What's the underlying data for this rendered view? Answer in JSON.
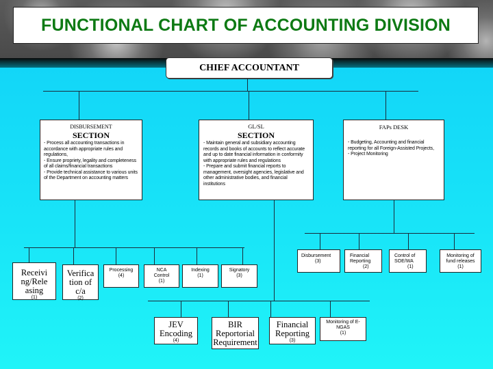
{
  "title": "FUNCTIONAL CHART OF ACCOUNTING DIVISION",
  "colors": {
    "title_text": "#0e7a14",
    "background_top": "#10d0f8",
    "background_bottom": "#20f4f8",
    "box_fill": "#ffffff",
    "line": "#1a2a3a"
  },
  "chief": {
    "label": "CHIEF ACCOUNTANT"
  },
  "sections": [
    {
      "name": "DISBURSEMENT",
      "subtitle": "SECTION",
      "body": "- Process all accounting transactions in accordance with appropriate rules and regulations,\n- Ensure propriety, legality and completeness of all claims/financial transactions\n- Provide technical assistance to various units of the Department on accounting matters"
    },
    {
      "name": "GL/SL",
      "subtitle": "SECTION",
      "body": "- Maintain general  and subsidiary accounting records and books of accounts to reflect accurate and up to date financial information in conformity with appropriate rules and regulations\n- Prepare and submit financial reports to management, oversight agencies, legislative and other administrative bodies, and financial institutions"
    },
    {
      "name": "FAPs DESK",
      "subtitle": "",
      "body": "- Budgeting, Accounting and financial reporting for all Foreign-Assisted Projects,\n- Project Monitoring"
    }
  ],
  "disbursement_units": [
    {
      "label": "Receivi ng/Rele asing",
      "count": "(1)"
    },
    {
      "label": "Verifica tion of c/a",
      "count": "(2)"
    },
    {
      "label": "Processing",
      "count": "(4)"
    },
    {
      "label": "NCA Control",
      "count": "(1)"
    },
    {
      "label": "Indexing",
      "count": "(1)"
    },
    {
      "label": "Signatory",
      "count": "(3)"
    }
  ],
  "glsl_units": [
    {
      "label": "JEV Encoding",
      "count": "(4)"
    },
    {
      "label": "BIR Reportorial Requirement",
      "count": ""
    },
    {
      "label": "Financial Reporting",
      "count": "(3)"
    },
    {
      "label": "Monitoring of E-NGAS",
      "count": "(1)"
    }
  ],
  "faps_units": [
    {
      "label": "Disbursement",
      "count": "(3)"
    },
    {
      "label": "Financial Reporting",
      "count": "(2)"
    },
    {
      "label": "Control of SOE/WA",
      "count": "(1)"
    },
    {
      "label": "Monitoring of fund releases",
      "count": "(1)"
    }
  ]
}
